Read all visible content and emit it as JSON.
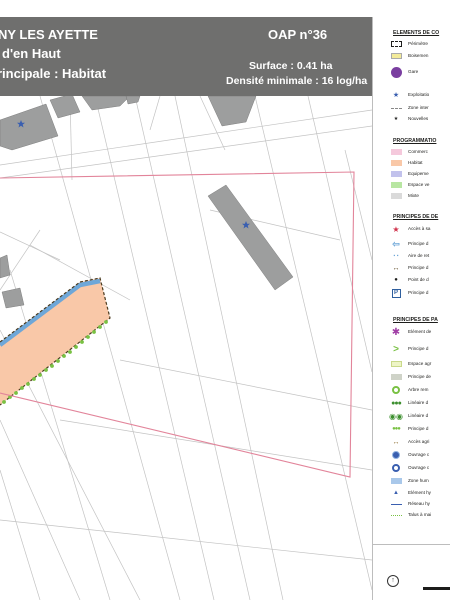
{
  "header": {
    "commune": "NY LES AYETTE",
    "secteur": "d'en Haut",
    "vocation": "rincipale : Habitat",
    "oap_number": "OAP n°36",
    "surface": "Surface : 0.41 ha",
    "densite": "Densité minimale : 16 log/ha"
  },
  "colors": {
    "header_band": "#6f6f6e",
    "perimeter": "#e2849a",
    "habitat_fill": "#f9c8a8",
    "hedge_green": "#79c143",
    "access_blue": "#6ea7d8",
    "building_grey": "#9d9e9e"
  },
  "legend": {
    "sections": [
      {
        "title": "ELEMENTS DE CO",
        "items": [
          {
            "label": "Périmètre",
            "symbol": "dashed-rectangle-icon"
          },
          {
            "label": "Boisemen",
            "symbol": "yellow-swatch-icon"
          },
          {
            "label": "Gare",
            "symbol": "train-station-icon"
          },
          {
            "label": "Exploitatio",
            "symbol": "blue-star-icon"
          },
          {
            "label": "Zone inter",
            "symbol": "dashed-line-icon"
          },
          {
            "label": "Nouvelles",
            "symbol": "small-star-icon"
          }
        ]
      },
      {
        "title": "PROGRAMMATIO",
        "items": [
          {
            "label": "Commerc",
            "symbol": "pink-swatch-icon"
          },
          {
            "label": "Habitat",
            "symbol": "orange-swatch-icon"
          },
          {
            "label": "Equipeme",
            "symbol": "lavender-swatch-icon"
          },
          {
            "label": "Espace ve",
            "symbol": "green-swatch-icon"
          },
          {
            "label": "Mixte",
            "symbol": "grey-swatch-icon"
          }
        ]
      },
      {
        "title": "PRINCIPES DE DE",
        "items": [
          {
            "label": "Accès à sa",
            "symbol": "red-star-icon"
          },
          {
            "label": "Principe d",
            "symbol": "blue-arrow-icon"
          },
          {
            "label": "Aire de ret",
            "symbol": "blue-dots-icon"
          },
          {
            "label": "Principe d",
            "symbol": "brown-double-arrow-icon"
          },
          {
            "label": "Point de d",
            "symbol": "bus-stop-icon"
          },
          {
            "label": "Principe d",
            "symbol": "parking-icon"
          }
        ]
      },
      {
        "title": "PRINCIPES DE PA",
        "items": [
          {
            "label": "Elément de",
            "symbol": "purple-flower-icon"
          },
          {
            "label": "Principe d",
            "symbol": "green-chevron-icon"
          },
          {
            "label": "Espace agr",
            "symbol": "light-green-swatch-icon"
          },
          {
            "label": "Principe de",
            "symbol": "grey-swatch-icon"
          },
          {
            "label": "Arbre rem",
            "symbol": "tree-circle-icon"
          },
          {
            "label": "Linéaire d",
            "symbol": "hedge-icon"
          },
          {
            "label": "Linéaire d",
            "symbol": "double-tree-icon"
          },
          {
            "label": "Principe d",
            "symbol": "green-dots-icon"
          },
          {
            "label": "Accès agri",
            "symbol": "brown-double-arrow-icon"
          },
          {
            "label": "Ouvrage c",
            "symbol": "blue-circle-icon"
          },
          {
            "label": "Ouvrage c",
            "symbol": "blue-ring-icon"
          },
          {
            "label": "Zone hum",
            "symbol": "blue-swatch-icon"
          },
          {
            "label": "Elément hy",
            "symbol": "blue-triangle-icon"
          },
          {
            "label": "Réseau hy",
            "symbol": "blue-line-icon"
          },
          {
            "label": "Talus à mai",
            "symbol": "green-dotted-line-icon"
          }
        ]
      }
    ]
  }
}
